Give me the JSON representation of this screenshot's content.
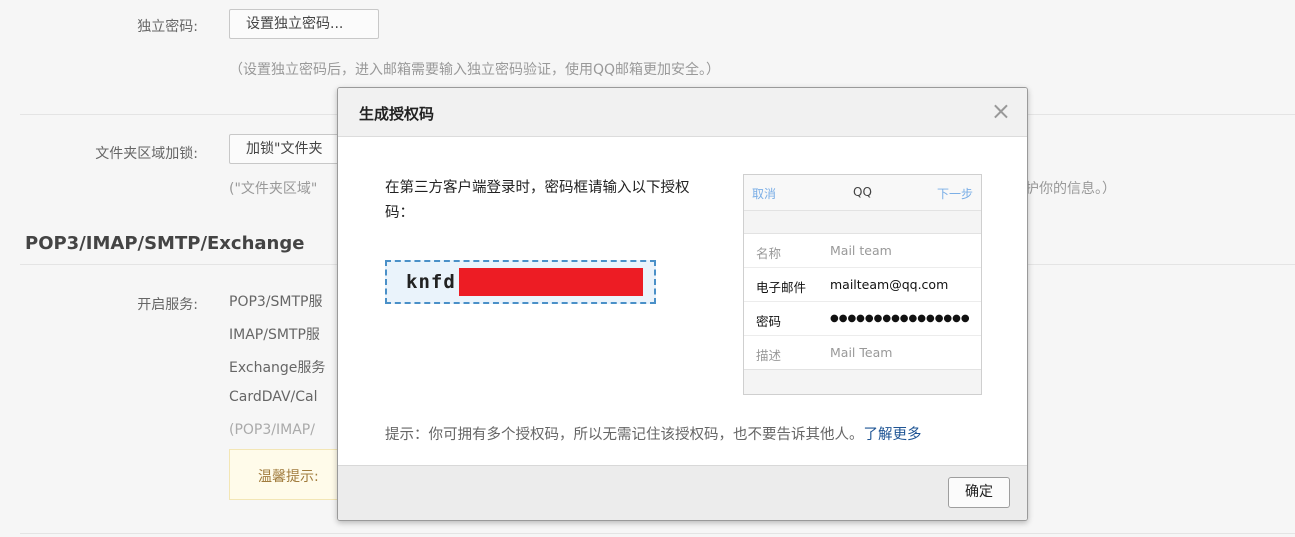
{
  "settings": {
    "independent_password": {
      "label": "独立密码:",
      "button": "设置独立密码...",
      "hint": "（设置独立密码后，进入邮箱需要输入独立密码验证，使用QQ邮箱更加安全。）"
    },
    "folder_lock": {
      "label": "文件夹区域加锁:",
      "button": "加锁\"文件夹",
      "hint_left": "(\"文件夹区域\"",
      "hint_right": "护你的信息。）"
    },
    "section_title": "POP3/IMAP/SMTP/Exchange",
    "services": {
      "label": "开启服务:",
      "items": [
        "POP3/SMTP服",
        "IMAP/SMTP服",
        "Exchange服务",
        "CardDAV/Cal",
        "(POP3/IMAP/"
      ]
    },
    "warm_tip": "温馨提示:"
  },
  "dialog": {
    "title": "生成授权码",
    "close_glyph": "×",
    "description": "在第三方客户端登录时，密码框请输入以下授权码：",
    "code_visible": "knfd",
    "phone": {
      "cancel": "取消",
      "title": "QQ",
      "next": "下一步",
      "rows": [
        {
          "key": "名称",
          "value": "Mail team"
        },
        {
          "key": "电子邮件",
          "value": "mailteam@qq.com"
        },
        {
          "key": "密码",
          "value": "●●●●●●●●●●●●●●●●"
        },
        {
          "key": "描述",
          "value": "Mail Team"
        }
      ]
    },
    "tip_text": "提示：你可拥有多个授权码，所以无需记住该授权码，也不要告诉其他人。",
    "tip_link": "了解更多",
    "ok_button": "确定"
  }
}
